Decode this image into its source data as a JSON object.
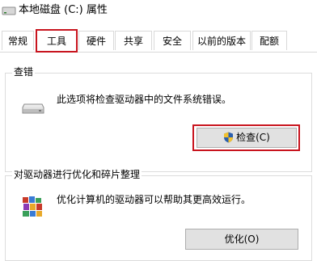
{
  "window": {
    "title": "本地磁盘 (C:) 属性"
  },
  "tabs": [
    {
      "label": "常规"
    },
    {
      "label": "工具"
    },
    {
      "label": "硬件"
    },
    {
      "label": "共享"
    },
    {
      "label": "安全"
    },
    {
      "label": "以前的版本"
    },
    {
      "label": "配额"
    }
  ],
  "active_tab": "工具",
  "error_check": {
    "title": "查错",
    "description": "此选项将检查驱动器中的文件系统错误。",
    "button_label": "检查(C)",
    "button_icon": "uac-shield-icon"
  },
  "optimize": {
    "title": "对驱动器进行优化和碎片整理",
    "description": "优化计算机的驱动器可以帮助其更高效运行。",
    "button_label": "优化(O)",
    "icon": "defrag-icon"
  },
  "colors": {
    "highlight": "#c8141e",
    "button_bg": "#e1e1e1",
    "border": "#d9d9d9"
  }
}
